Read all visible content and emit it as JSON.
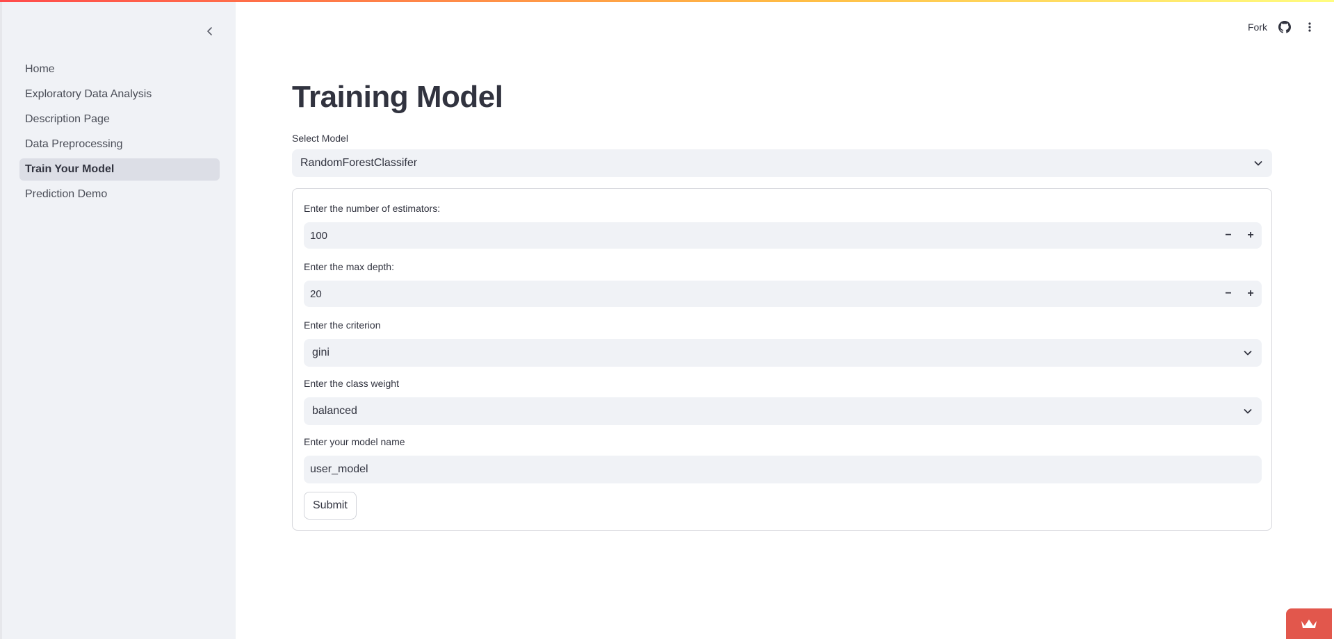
{
  "sidebar": {
    "items": [
      {
        "label": "Home"
      },
      {
        "label": "Exploratory Data Analysis"
      },
      {
        "label": "Description Page"
      },
      {
        "label": "Data Preprocessing"
      },
      {
        "label": "Train Your Model",
        "active": true
      },
      {
        "label": "Prediction Demo"
      }
    ]
  },
  "toolbar": {
    "fork_label": "Fork",
    "icons": [
      "github-icon",
      "more-vertical-icon"
    ]
  },
  "main": {
    "title": "Training Model",
    "select_model": {
      "label": "Select Model",
      "value": "RandomForestClassifer"
    },
    "form": {
      "estimators": {
        "label": "Enter the number of estimators:",
        "value": "100",
        "minus": "−",
        "plus": "+"
      },
      "max_depth": {
        "label": "Enter the max depth:",
        "value": "20",
        "minus": "−",
        "plus": "+"
      },
      "criterion": {
        "label": "Enter the criterion",
        "value": "gini"
      },
      "class_weight": {
        "label": "Enter the class weight",
        "value": "balanced"
      },
      "model_name": {
        "label": "Enter your model name",
        "value": "user_model"
      },
      "submit_label": "Submit"
    }
  },
  "colors": {
    "accent": "#ff4b4b",
    "sidebar_bg": "#f0f2f6",
    "input_bg": "#f0f2f6",
    "badge_bg": "#e2574c",
    "text": "#31333f"
  }
}
